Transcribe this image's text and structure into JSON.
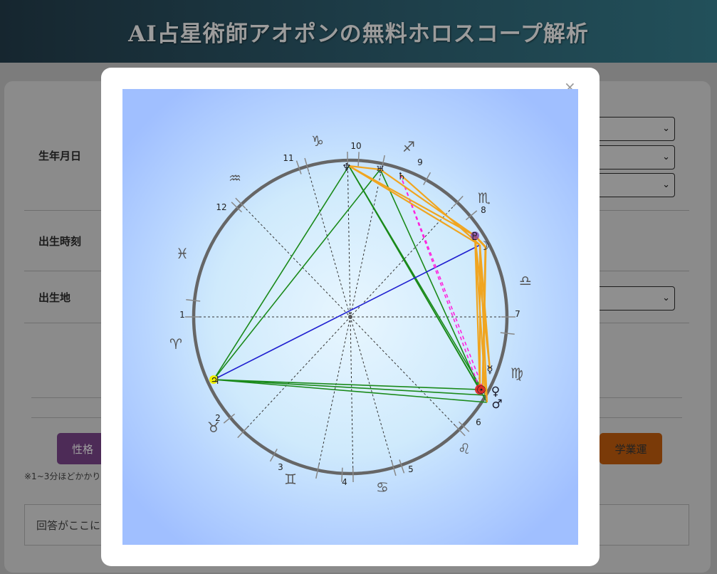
{
  "header": {
    "title": "AI占星術師アオポンの無料ホロスコープ解析"
  },
  "form": {
    "birth_date_label": "生年月日",
    "birth_time_label": "出生時刻",
    "birth_place_label": "出生地"
  },
  "buttons": {
    "personality": "性格",
    "study_luck": "学業運"
  },
  "note": "※1~3分ほどかかり",
  "answer": {
    "placeholder": "回答がここに"
  },
  "modal": {
    "close_symbol": "×"
  },
  "chart": {
    "house_numbers": [
      "1",
      "2",
      "3",
      "4",
      "5",
      "6",
      "7",
      "8",
      "9",
      "10",
      "11",
      "12"
    ],
    "zodiac": {
      "aries": "♈",
      "taurus": "♉",
      "gemini": "♊",
      "cancer": "♋",
      "leo": "♌",
      "virgo": "♍",
      "libra": "♎",
      "scorpio": "♏",
      "sagittarius": "♐",
      "capricorn": "♑",
      "aquarius": "♒",
      "pisces": "♓"
    },
    "planets": {
      "neptune": "♆",
      "uranus": "♅",
      "saturn": "♄",
      "pluto": "♇",
      "moon": "☽",
      "mercury": "☿",
      "sun": "☉",
      "venus": "♀",
      "mars": "♂",
      "jupiter": "♃"
    },
    "colors": {
      "background": "#a5c3ff",
      "circle": "#666666",
      "trine": "#1a8a1a",
      "sextile": "#f0a520",
      "opposition": "#2020d0",
      "quincunx": "#ff22dd",
      "sun": "#e02020",
      "jupiter": "#f0f000",
      "pluto": "#7b2fa0"
    }
  }
}
